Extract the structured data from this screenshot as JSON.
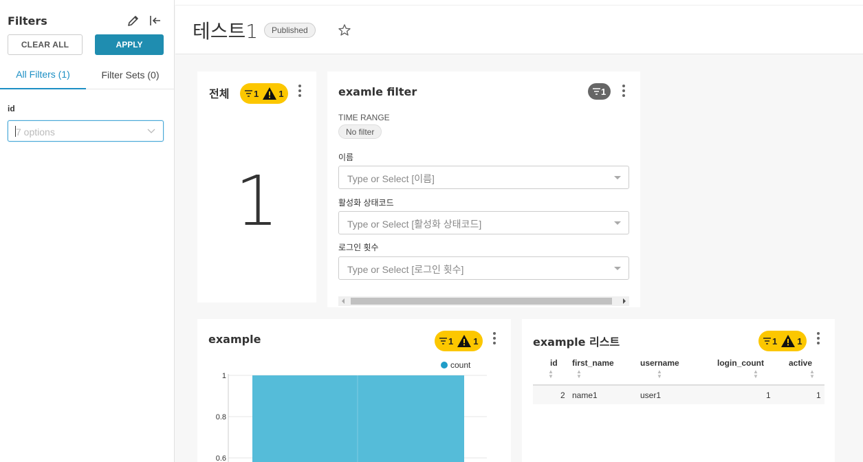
{
  "sidebar": {
    "title": "Filters",
    "clear_all": "CLEAR ALL",
    "apply": "APPLY",
    "tabs": [
      "All Filters (1)",
      "Filter Sets (0)"
    ],
    "filter_label": "id",
    "filter_placeholder": "7 options"
  },
  "header": {
    "title": "테스트1",
    "status": "Published"
  },
  "card_total": {
    "title": "전체",
    "badge_filters": "1",
    "badge_warnings": "1",
    "value": "1"
  },
  "card_filter": {
    "title": "examle filter",
    "badge_filters": "1",
    "time_range_label": "TIME RANGE",
    "time_range_value": "No filter",
    "fields": [
      {
        "label": "이름",
        "placeholder": "Type or Select [이름]"
      },
      {
        "label": "활성화 상태코드",
        "placeholder": "Type or Select [활성화 상태코드]"
      },
      {
        "label": "로그인 횟수",
        "placeholder": "Type or Select [로그인 횟수]"
      }
    ]
  },
  "card_example": {
    "title": "example",
    "badge_filters": "1",
    "badge_warnings": "1"
  },
  "card_list": {
    "title": "example 리스트",
    "badge_filters": "1",
    "badge_warnings": "1",
    "columns": [
      "id",
      "first_name",
      "username",
      "login_count",
      "active"
    ],
    "rows": [
      [
        "2",
        "name1",
        "user1",
        "1",
        "1"
      ]
    ]
  },
  "colors": {
    "accent": "#1f8db0",
    "badge_yellow": "#fcc700",
    "bar": "#55bcd9"
  },
  "chart_data": {
    "type": "bar",
    "categories": [
      ""
    ],
    "series": [
      {
        "name": "count",
        "values": [
          1
        ]
      }
    ],
    "yticks": [
      "1",
      "0.8",
      "0.6"
    ],
    "ylim": [
      0,
      1
    ],
    "legend": "top-right",
    "grid": true
  }
}
